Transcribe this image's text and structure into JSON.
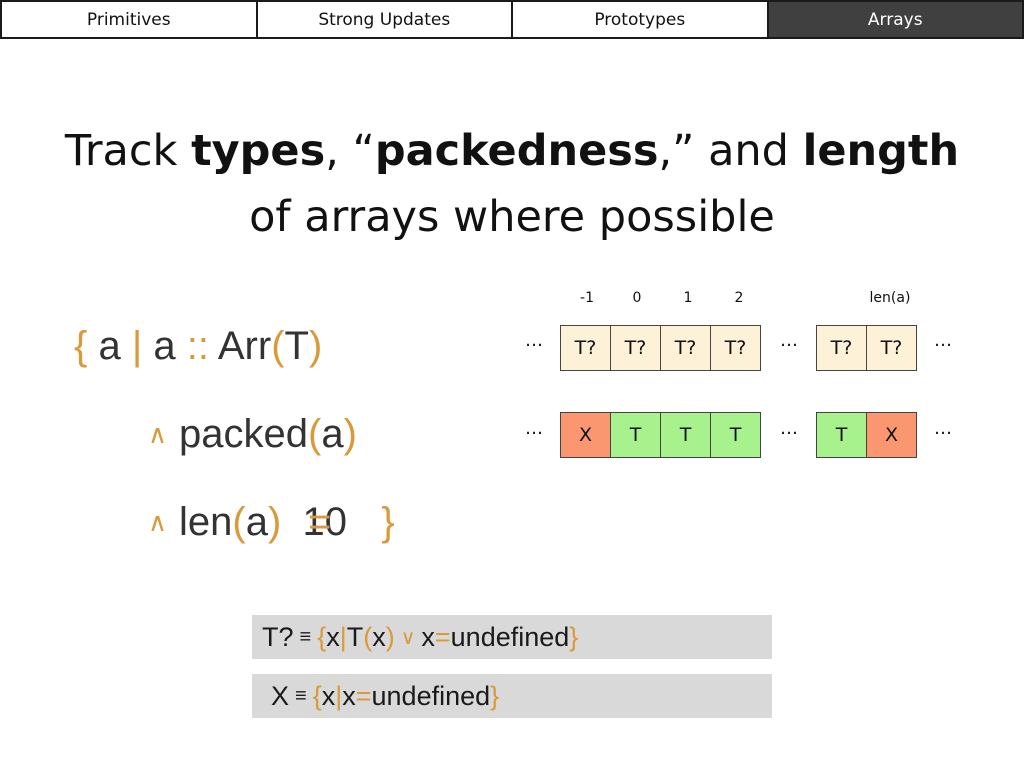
{
  "tabs": [
    {
      "label": "Primitives",
      "active": false
    },
    {
      "label": "Strong Updates",
      "active": false
    },
    {
      "label": "Prototypes",
      "active": false
    },
    {
      "label": "Arrays",
      "active": true
    }
  ],
  "title": {
    "l1_a": "Track ",
    "l1_b": "types",
    "l1_c": ", “",
    "l1_d": "packedness",
    "l1_e": ",” and ",
    "l1_f": "length",
    "line2": "of arrays where possible"
  },
  "formula": {
    "brace_open": "{",
    "a1": " a ",
    "bar": "|",
    "a2": " a ",
    "dcolon": "::",
    "arr": " Arr",
    "lp": "(",
    "t": "T",
    "rp": ")",
    "and_sym": "∧",
    "packed": "packed",
    "len": "len",
    "a": "a",
    "eq": "=",
    "ten": " 10 ",
    "brace_close": "}"
  },
  "diagram": {
    "indices": [
      "-1",
      "0",
      "1",
      "2",
      "len(a)"
    ],
    "ellipsis": "…",
    "row1": [
      "T?",
      "T?",
      "T?",
      "T?",
      "T?",
      "T?"
    ],
    "row2": [
      "X",
      "T",
      "T",
      "T",
      "T",
      "X"
    ]
  },
  "colors": {
    "accent_gold": "#d99a3a",
    "cell_maybe": "#fdf1d8",
    "cell_true": "#a8f28e",
    "cell_hole": "#fa9670",
    "def_box": "#d9d9d9",
    "tab_active": "#404040"
  },
  "defs": {
    "d1": {
      "lhs": "T?",
      "equiv": "≡",
      "lb": "{",
      "x": " x ",
      "bar": "|",
      "t": " T",
      "lp": "(",
      "x2": "x",
      "rp": ")",
      "or": "∨",
      "x3": " x ",
      "eq": "=",
      "undef": " undefined ",
      "rb": "}"
    },
    "d2": {
      "lhs": "X",
      "equiv": "≡",
      "lb": "{",
      "x": " x ",
      "bar": "|",
      "x2": " x ",
      "eq": "=",
      "undef": " undefined ",
      "rb": "}"
    }
  }
}
